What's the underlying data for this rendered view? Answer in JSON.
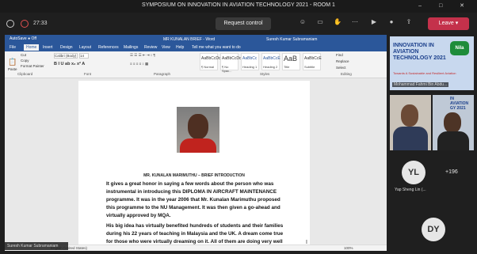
{
  "window": {
    "title": "SYMPOSIUM ON INNOVATION IN AVIATION TECHNOLOGY 2021 - ROOM 1",
    "controls": "–  □  ✕"
  },
  "call": {
    "timer": "27:33",
    "request_control": "Request control",
    "leave": "Leave",
    "leave_chevron": "▾"
  },
  "word": {
    "quick_access": "AutoSave ● Off",
    "doc_title": "MR KUNALAN BRIEF  -  Word",
    "user": "Suresh Kumar Subramaniam",
    "tabs": [
      "File",
      "Home",
      "Insert",
      "Design",
      "Layout",
      "References",
      "Mailings",
      "Review",
      "View",
      "Help",
      "Tell me what you want to do"
    ],
    "ribbon": {
      "clipboard_label": "Clipboard",
      "font_label": "Font",
      "paragraph_label": "Paragraph",
      "styles_label": "Styles",
      "editing_label": "Editing",
      "paste": "Paste",
      "cut": "Cut",
      "copy": "Copy",
      "format_painter": "Format Painter",
      "font_name": "Calibri (Body)",
      "font_size": "14",
      "find": "Find",
      "replace": "Replace",
      "select": "Select",
      "styles": [
        {
          "sample": "AaBbCcDc",
          "name": "¶ Normal"
        },
        {
          "sample": "AaBbCcDc",
          "name": "¶ No Spac..."
        },
        {
          "sample": "AaBbCc",
          "name": "Heading 1"
        },
        {
          "sample": "AaBbCcE",
          "name": "Heading 2"
        },
        {
          "sample": "AaB",
          "name": "Title"
        },
        {
          "sample": "AaBbCcE",
          "name": "Subtitle"
        }
      ]
    },
    "document": {
      "heading": "MR. KUNALAN MARIMUTHU – BRIEF INTRODUCTION",
      "para1": "It gives a great honor in saying a few words about the person who was instrumental in introducing this DIPLOMA IN AIRCRAFT MAINTENANCE programme. It was in the year 2006 that Mr. Kunalan Marimuthu proposed this programme to the NU Management. It was then given a go-ahead and virtually approved by MQA.",
      "para2": "His big idea has virtually benefited hundreds of students and their families during his 22 years of teaching in Malaysia and the UK. A dream come true for those who were virtually dreaming on it. All of them are doing very well in their designated jobs. In this context, this gentleman had also introduced"
    },
    "status": {
      "language": "English (United States)",
      "zoom": "100%"
    }
  },
  "presenter_name": "Suresh Kumar Subramaniam",
  "participants": {
    "tile1_label": "Mohammad Fahmi Bin Abdu...",
    "slide_heading": "INNOVATION IN AVIATION TECHNOLOGY 2021",
    "slide_tagline": "Towards A Sustainable and Resilient Aviation",
    "slide_heading_small": "IN AVIATION GY 2021",
    "yl_initials": "YL",
    "yl_name": "Yap Sheng Lin (...",
    "more_count": "+196",
    "dy_initials": "DY"
  }
}
